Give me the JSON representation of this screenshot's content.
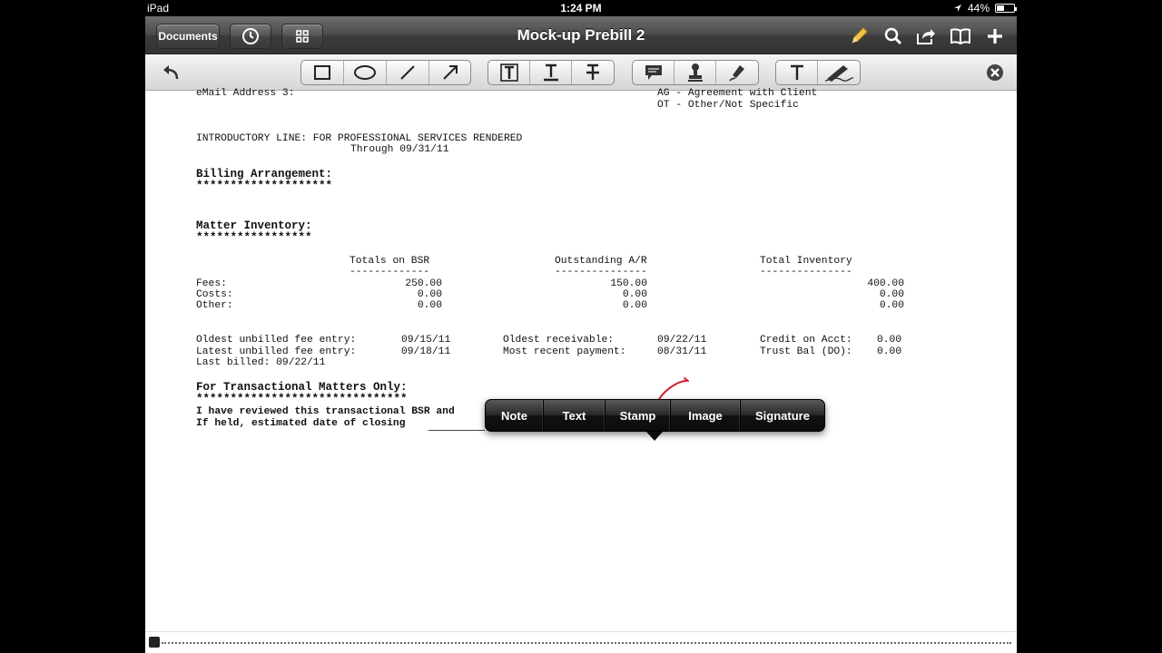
{
  "status_bar": {
    "device": "iPad",
    "time": "1:24 PM",
    "battery": "44%",
    "battery_level": 0.44
  },
  "navbar": {
    "title": "Mock-up Prebill 2",
    "documents_label": "Documents"
  },
  "document": {
    "email_line": "eMail Address 3:",
    "codes": [
      "AG - Agreement with Client",
      "OT - Other/Not Specific"
    ],
    "intro_line": "INTRODUCTORY LINE: FOR PROFESSIONAL SERVICES RENDERED",
    "through": "Through 09/31/11",
    "billing_heading": "Billing Arrangement:",
    "billing_stars": "********************",
    "matter_heading": "Matter Inventory:",
    "matter_stars": "*****************",
    "inventory_headers": [
      "Totals on BSR",
      "Outstanding A/R",
      "Total Inventory"
    ],
    "inventory_underlines": [
      "-------------",
      "---------------",
      "---------------"
    ],
    "inventory_rows": [
      {
        "label": "Fees:",
        "bsr": "250.00",
        "ar": "150.00",
        "total": "400.00"
      },
      {
        "label": "Costs:",
        "bsr": "0.00",
        "ar": "0.00",
        "total": "0.00"
      },
      {
        "label": "Other:",
        "bsr": "0.00",
        "ar": "0.00",
        "total": "0.00"
      }
    ],
    "oldest_unbilled_label": "Oldest unbilled fee entry:",
    "oldest_unbilled_value": "09/15/11",
    "latest_unbilled_label": "Latest unbilled fee entry:",
    "latest_unbilled_value": "09/18/11",
    "last_billed": "Last billed: 09/22/11",
    "oldest_receivable_label": "Oldest receivable:",
    "oldest_receivable_value": "09/22/11",
    "recent_payment_label": "Most recent payment:",
    "recent_payment_value": "08/31/11",
    "credit_label": "Credit on Acct:",
    "credit_value": "0.00",
    "trust_label": "Trust Bal (DO):",
    "trust_value": "0.00",
    "transactional_heading": "For Transactional Matters Only:",
    "transactional_stars": "*******************************",
    "reviewed_line": "I have reviewed this transactional BSR and",
    "held_line": "If held, estimated date of closing"
  },
  "popup_menu": [
    "Note",
    "Text",
    "Stamp",
    "Image",
    "Signature"
  ],
  "colors": {
    "annotation_stroke": "#d11f2a",
    "navbar": "#3c3c3c",
    "popup": "#111111"
  },
  "icons": {
    "nav": [
      "clock-icon",
      "grid-icon",
      "pencil-icon",
      "search-icon",
      "share-icon",
      "book-icon",
      "plus-icon"
    ],
    "toolbar": [
      "undo-icon",
      "rectangle-icon",
      "ellipse-icon",
      "line-icon",
      "arrow-icon",
      "text-highlight-icon",
      "text-underline-icon",
      "text-strikeout-icon",
      "note-icon",
      "stamp-icon",
      "signature-pen-icon",
      "freetext-icon",
      "freehand-icon",
      "close-icon"
    ]
  }
}
